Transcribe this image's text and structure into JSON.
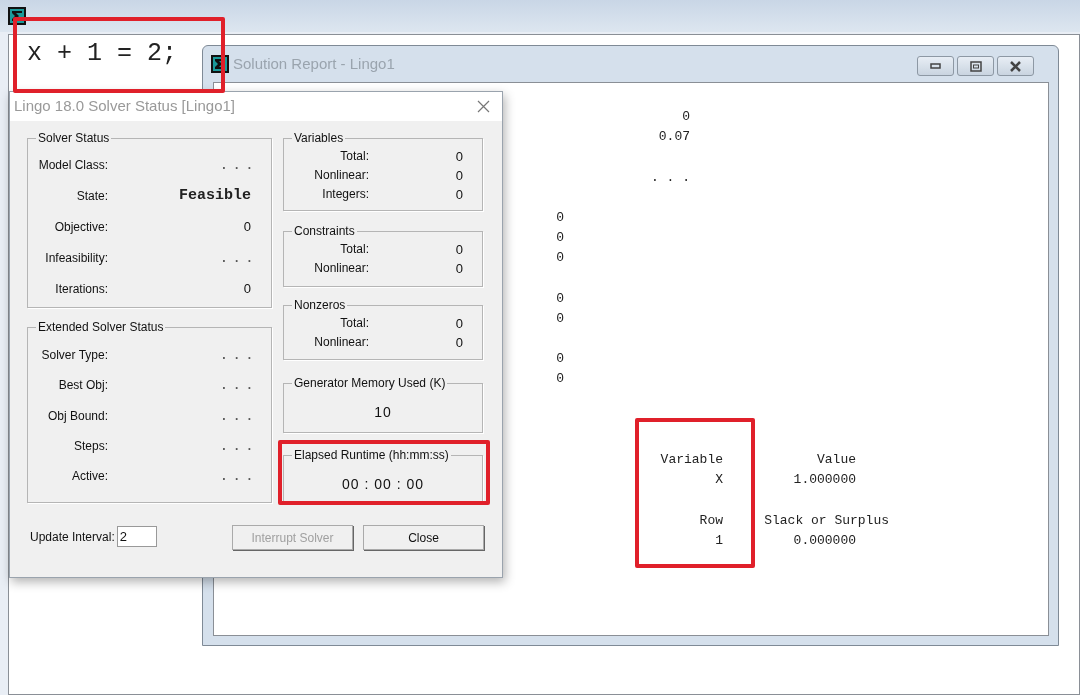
{
  "model_window": {
    "code": "x + 1 = 2;"
  },
  "report_window": {
    "title": "Solution Report - Lingo1",
    "lines": [
      {
        "kind": "summary",
        "cells": [
          "0"
        ]
      },
      {
        "kind": "summary",
        "cells": [
          "0.07"
        ]
      },
      {
        "kind": "blank"
      },
      {
        "kind": "summary",
        "cells": [
          ". . ."
        ]
      },
      {
        "kind": "blank"
      },
      {
        "kind": "count",
        "cells": [
          "0"
        ]
      },
      {
        "kind": "count",
        "cells": [
          "0"
        ]
      },
      {
        "kind": "count",
        "cells": [
          "0"
        ]
      },
      {
        "kind": "blank"
      },
      {
        "kind": "count",
        "cells": [
          "0"
        ]
      },
      {
        "kind": "count",
        "cells": [
          "0"
        ]
      },
      {
        "kind": "blank"
      },
      {
        "kind": "count",
        "cells": [
          "0"
        ]
      },
      {
        "kind": "count",
        "cells": [
          "0"
        ]
      },
      {
        "kind": "blank"
      },
      {
        "kind": "blank"
      },
      {
        "kind": "blank"
      },
      {
        "kind": "table",
        "cells": [
          "Variable",
          "Value"
        ]
      },
      {
        "kind": "table",
        "cells": [
          "X",
          "1.000000"
        ]
      },
      {
        "kind": "blank"
      },
      {
        "kind": "wide",
        "cells": [
          "Row",
          "Slack or Surplus"
        ]
      },
      {
        "kind": "table",
        "cells": [
          "1",
          "0.000000"
        ]
      }
    ]
  },
  "solver_dialog": {
    "title": "Lingo 18.0 Solver Status [Lingo1]",
    "solver_status": {
      "title": "Solver Status",
      "rows": [
        {
          "label": "Model Class:",
          "value": ". . .",
          "kind": "pending"
        },
        {
          "label": "State:",
          "value": "Feasible",
          "kind": "mono"
        },
        {
          "label": "Objective:",
          "value": "0",
          "kind": "plain"
        },
        {
          "label": "Infeasibility:",
          "value": ". . .",
          "kind": "pending"
        },
        {
          "label": "Iterations:",
          "value": "0",
          "kind": "plain"
        }
      ]
    },
    "extended_solver_status": {
      "title": "Extended Solver Status",
      "rows": [
        {
          "label": "Solver Type:",
          "value": ". . .",
          "kind": "pending"
        },
        {
          "label": "Best Obj:",
          "value": ". . .",
          "kind": "pending"
        },
        {
          "label": "Obj Bound:",
          "value": ". . .",
          "kind": "pending"
        },
        {
          "label": "Steps:",
          "value": ". . .",
          "kind": "pending"
        },
        {
          "label": "Active:",
          "value": ". . .",
          "kind": "pending"
        }
      ]
    },
    "variables": {
      "title": "Variables",
      "rows": [
        {
          "label": "Total:",
          "value": "0"
        },
        {
          "label": "Nonlinear:",
          "value": "0"
        },
        {
          "label": "Integers:",
          "value": "0"
        }
      ]
    },
    "constraints": {
      "title": "Constraints",
      "rows": [
        {
          "label": "Total:",
          "value": "0"
        },
        {
          "label": "Nonlinear:",
          "value": "0"
        }
      ]
    },
    "nonzeros": {
      "title": "Nonzeros",
      "rows": [
        {
          "label": "Total:",
          "value": "0"
        },
        {
          "label": "Nonlinear:",
          "value": "0"
        }
      ]
    },
    "generator_memory": {
      "title": "Generator Memory Used (K)",
      "value": "10"
    },
    "elapsed_runtime": {
      "title": "Elapsed Runtime (hh:mm:ss)",
      "value": "00 : 00 : 00"
    },
    "update_interval": {
      "label": "Update Interval:",
      "value": "2"
    },
    "buttons": [
      {
        "label": "Interrupt Solver",
        "disabled": true
      },
      {
        "label": "Close",
        "disabled": false
      }
    ]
  }
}
